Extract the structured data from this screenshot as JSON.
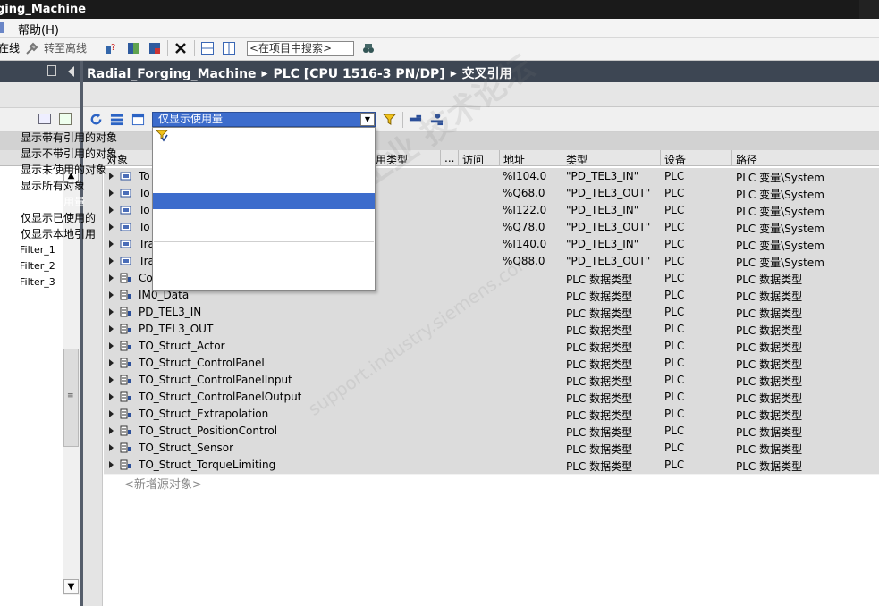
{
  "window": {
    "title": "ging_Machine"
  },
  "menu": {
    "help": "帮助(H)"
  },
  "toolbar": {
    "online_partial": "在线",
    "go_offline": "转至离线",
    "search_placeholder": "<在项目中搜索>"
  },
  "breadcrumb": {
    "project": "Radial_Forging_Machine",
    "device": "PLC [CPU 1516-3 PN/DP]",
    "view": "交叉引用"
  },
  "filter": {
    "selected": "仅显示使用量",
    "options": [
      "显示带有引用的对象",
      "显示不带引用的对象",
      "显示未使用的对象",
      "显示所有对象",
      "仅显示使用量",
      "仅显示已使用的",
      "仅显示本地引用"
    ],
    "custom": [
      "Filter_1",
      "Filter_2",
      "Filter_3"
    ]
  },
  "columns": {
    "object": "对象",
    "ref_type": "用类型",
    "more": "...",
    "access": "访问",
    "address": "地址",
    "type": "类型",
    "device": "设备",
    "path": "路径"
  },
  "rows": [
    {
      "name": "To",
      "address": "%I104.0",
      "type": "\"PD_TEL3_IN\"",
      "device": "PLC",
      "path": "PLC 变量\\System"
    },
    {
      "name": "To",
      "address": "%Q68.0",
      "type": "\"PD_TEL3_OUT\"",
      "device": "PLC",
      "path": "PLC 变量\\System"
    },
    {
      "name": "To",
      "address": "%I122.0",
      "type": "\"PD_TEL3_IN\"",
      "device": "PLC",
      "path": "PLC 变量\\System"
    },
    {
      "name": "To",
      "address": "%Q78.0",
      "type": "\"PD_TEL3_OUT\"",
      "device": "PLC",
      "path": "PLC 变量\\System"
    },
    {
      "name": "Tra",
      "address": "%I140.0",
      "type": "\"PD_TEL3_IN\"",
      "device": "PLC",
      "path": "PLC 变量\\System"
    },
    {
      "name": "Tra",
      "address": "%Q88.0",
      "type": "\"PD_TEL3_OUT\"",
      "device": "PLC",
      "path": "PLC 变量\\System"
    },
    {
      "name": "Co",
      "address": "",
      "type": "PLC 数据类型",
      "device": "PLC",
      "path": "PLC 数据类型"
    },
    {
      "name": "IM0_Data",
      "address": "",
      "type": "PLC 数据类型",
      "device": "PLC",
      "path": "PLC 数据类型"
    },
    {
      "name": "PD_TEL3_IN",
      "address": "",
      "type": "PLC 数据类型",
      "device": "PLC",
      "path": "PLC 数据类型"
    },
    {
      "name": "PD_TEL3_OUT",
      "address": "",
      "type": "PLC 数据类型",
      "device": "PLC",
      "path": "PLC 数据类型"
    },
    {
      "name": "TO_Struct_Actor",
      "address": "",
      "type": "PLC 数据类型",
      "device": "PLC",
      "path": "PLC 数据类型"
    },
    {
      "name": "TO_Struct_ControlPanel",
      "address": "",
      "type": "PLC 数据类型",
      "device": "PLC",
      "path": "PLC 数据类型"
    },
    {
      "name": "TO_Struct_ControlPanelInput",
      "address": "",
      "type": "PLC 数据类型",
      "device": "PLC",
      "path": "PLC 数据类型"
    },
    {
      "name": "TO_Struct_ControlPanelOutput",
      "address": "",
      "type": "PLC 数据类型",
      "device": "PLC",
      "path": "PLC 数据类型"
    },
    {
      "name": "TO_Struct_Extrapolation",
      "address": "",
      "type": "PLC 数据类型",
      "device": "PLC",
      "path": "PLC 数据类型"
    },
    {
      "name": "TO_Struct_PositionControl",
      "address": "",
      "type": "PLC 数据类型",
      "device": "PLC",
      "path": "PLC 数据类型"
    },
    {
      "name": "TO_Struct_Sensor",
      "address": "",
      "type": "PLC 数据类型",
      "device": "PLC",
      "path": "PLC 数据类型"
    },
    {
      "name": "TO_Struct_TorqueLimiting",
      "address": "",
      "type": "PLC 数据类型",
      "device": "PLC",
      "path": "PLC 数据类型"
    }
  ],
  "new_object": "<新增源对象>",
  "watermark": {
    "main": "西门子工业 技术论坛",
    "sub": "support.industry.siemens.com"
  },
  "colors": {
    "accent": "#3c6ccc",
    "header_bar": "#3d4653"
  }
}
